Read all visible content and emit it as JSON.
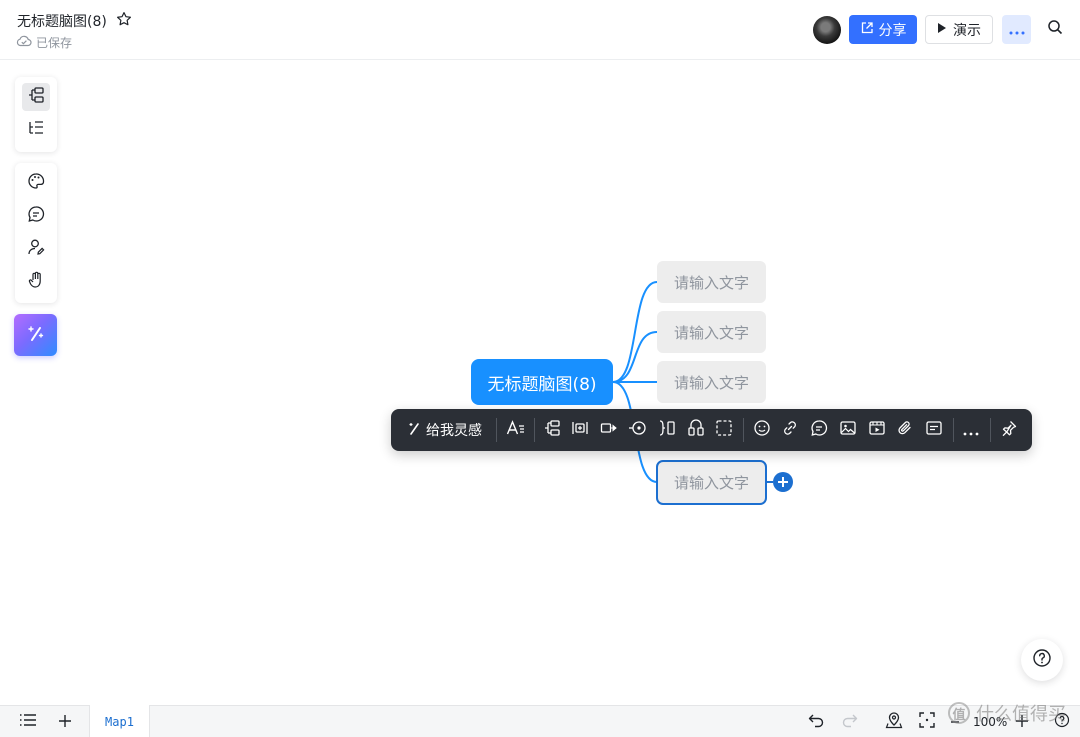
{
  "header": {
    "title": "无标题脑图(8)",
    "saved_status": "已保存",
    "share_label": "分享",
    "present_label": "演示"
  },
  "mindmap": {
    "root": "无标题脑图(8)",
    "children": [
      "请输入文字",
      "请输入文字",
      "请输入文字",
      "请输入文字"
    ]
  },
  "floating_toolbar": {
    "inspire_label": "给我灵感"
  },
  "bottom_bar": {
    "sheet_tab": "Map1",
    "zoom": "100%"
  },
  "watermark": {
    "text": "什么值得买",
    "logo": "值"
  },
  "colors": {
    "accent": "#3370ff",
    "root_node": "#1890ff",
    "connector": "#1890ff",
    "selected_border": "#1c6fd0",
    "toolbar_bg": "#2b2f36"
  }
}
